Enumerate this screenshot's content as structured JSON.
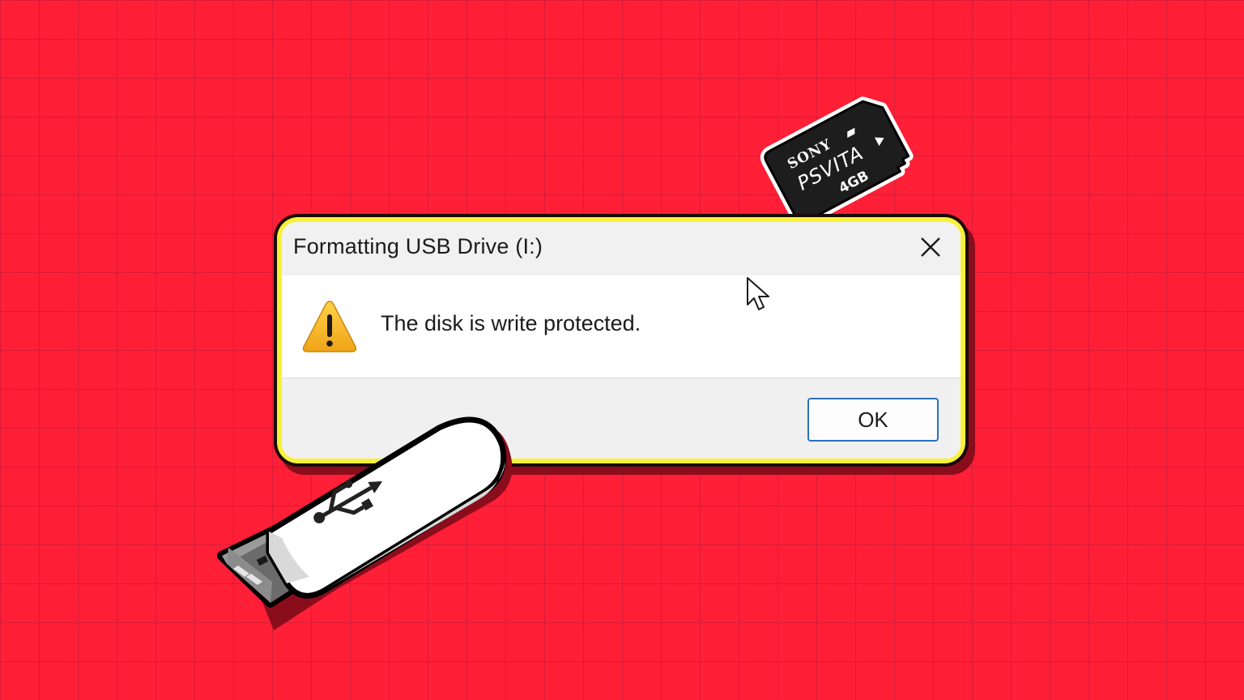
{
  "dialog": {
    "title": "Formatting USB Drive (I:)",
    "message": "The disk is write protected.",
    "ok_label": "OK",
    "close_icon": "close-icon",
    "warning_icon": "warning-icon"
  },
  "memory_card": {
    "brand": "SONY",
    "product": "PSVITA",
    "capacity": "4GB"
  },
  "colors": {
    "background": "#ff1f36",
    "dialog_border": "#f7f13a",
    "ok_button_border": "#2a6fbd",
    "warning": "#f5b51f"
  }
}
